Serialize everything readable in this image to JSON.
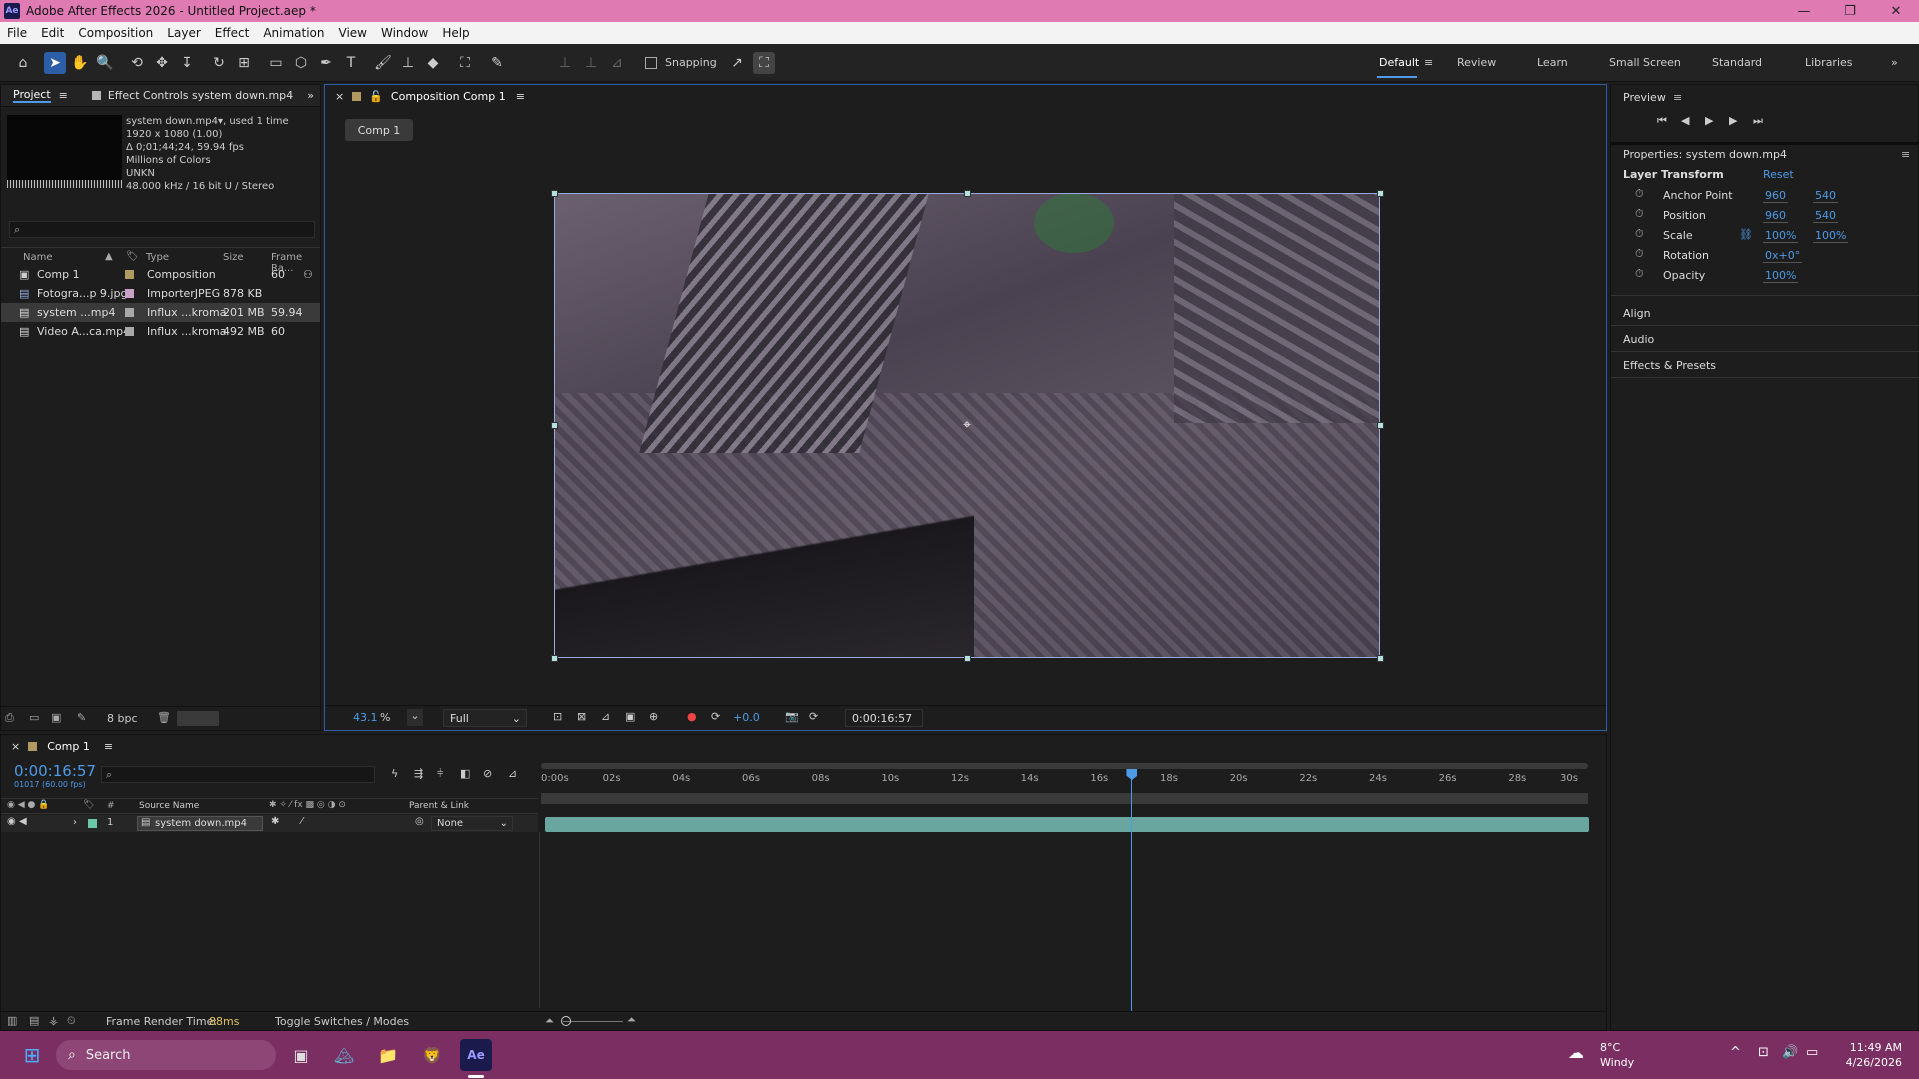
{
  "titlebar": {
    "app_icon": "Ae",
    "title": "Adobe After Effects 2026 - Untitled Project.aep *"
  },
  "menu": [
    "File",
    "Edit",
    "Composition",
    "Layer",
    "Effect",
    "Animation",
    "View",
    "Window",
    "Help"
  ],
  "toolbar": {
    "snapping_label": "Snapping",
    "workspaces": [
      "Default",
      "Review",
      "Learn",
      "Small Screen",
      "Standard",
      "Libraries"
    ],
    "active_workspace": "Default"
  },
  "project": {
    "tab_label": "Project",
    "effect_controls_tab": "Effect Controls system down.mp4",
    "info": {
      "name": "system down.mp4",
      "used": ", used 1 time",
      "dims": "1920 x 1080 (1.00)",
      "duration": "Δ 0;01;44;24, 59.94 fps",
      "colors": "Millions of Colors",
      "codec": "UNKN",
      "audio": "48.000 kHz / 16 bit U / Stereo"
    },
    "columns": [
      "Name",
      "Type",
      "Size",
      "Frame Ra..."
    ],
    "items": [
      {
        "name": "Comp 1",
        "type": "Composition",
        "size": "",
        "fps": "60",
        "color": "#b09a60"
      },
      {
        "name": "Fotogra...p 9.jpg",
        "type": "ImporterJPEG",
        "size": "878 KB",
        "fps": "",
        "color": "#c8a0c8"
      },
      {
        "name": "system ...mp4",
        "type": "Influx ...kroma",
        "size": "201 MB",
        "fps": "59.94",
        "color": "#a8a8a8"
      },
      {
        "name": "Video A...ca.mp4",
        "type": "Influx ...kroma",
        "size": "492 MB",
        "fps": "60",
        "color": "#a8a8a8"
      }
    ],
    "bpc": "8 bpc"
  },
  "composition": {
    "tab_label": "Composition Comp 1",
    "comp_tab": "Comp 1",
    "zoom": "43.1",
    "zoom_unit": "%",
    "resolution": "Full",
    "exposure": "+0.0",
    "timecode": "0:00:16:57"
  },
  "preview": {
    "label": "Preview"
  },
  "properties": {
    "title": "Properties: system down.mp4",
    "section": "Layer Transform",
    "reset": "Reset",
    "rows": [
      {
        "name": "Anchor Point",
        "v1": "960",
        "v2": "540"
      },
      {
        "name": "Position",
        "v1": "960",
        "v2": "540"
      },
      {
        "name": "Scale",
        "v1": "100%",
        "v2": "100%"
      },
      {
        "name": "Rotation",
        "v1": "0x+0°",
        "v2": ""
      },
      {
        "name": "Opacity",
        "v1": "100%",
        "v2": ""
      }
    ],
    "collapsed": [
      "Align",
      "Audio",
      "Effects & Presets"
    ]
  },
  "timeline": {
    "tab_label": "Comp 1",
    "timecode": "0:00:16:57",
    "frame_info": "01017 (60.00 fps)",
    "col_source": "Source Name",
    "col_parent": "Parent & Link",
    "layer": {
      "index": "1",
      "name": "system down.mp4",
      "parent": "None"
    },
    "ticks": [
      "0:00s",
      "02s",
      "04s",
      "06s",
      "08s",
      "10s",
      "12s",
      "14s",
      "16s",
      "18s",
      "20s",
      "22s",
      "24s",
      "26s",
      "28s",
      "30s"
    ],
    "playhead_fraction": 0.565,
    "render_label": "Frame Render Time:",
    "render_value": "88ms",
    "toggle_label": "Toggle Switches / Modes"
  },
  "taskbar": {
    "search": "Search",
    "weather_temp": "8°C",
    "weather_desc": "Windy",
    "time": "11:49 AM",
    "date": "4/26/2026"
  }
}
